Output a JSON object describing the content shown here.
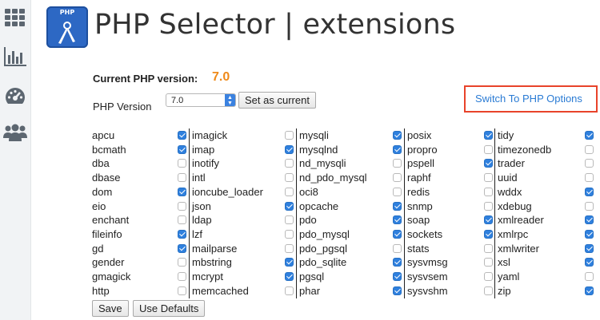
{
  "header": {
    "logo_text": "PHP",
    "title": "PHP Selector | extensions"
  },
  "current_version": {
    "label": "Current PHP version:",
    "value": "7.0"
  },
  "php_version": {
    "label": "PHP Version",
    "selected": "7.0",
    "set_current_label": "Set as current"
  },
  "switch_link": "Switch To PHP Options",
  "columns": [
    [
      {
        "name": "apcu",
        "checked": true
      },
      {
        "name": "bcmath",
        "checked": true
      },
      {
        "name": "dba",
        "checked": false
      },
      {
        "name": "dbase",
        "checked": false
      },
      {
        "name": "dom",
        "checked": true
      },
      {
        "name": "eio",
        "checked": false
      },
      {
        "name": "enchant",
        "checked": false
      },
      {
        "name": "fileinfo",
        "checked": true
      },
      {
        "name": "gd",
        "checked": true
      },
      {
        "name": "gender",
        "checked": false
      },
      {
        "name": "gmagick",
        "checked": false
      },
      {
        "name": "http",
        "checked": false
      }
    ],
    [
      {
        "name": "imagick",
        "checked": false
      },
      {
        "name": "imap",
        "checked": true
      },
      {
        "name": "inotify",
        "checked": false
      },
      {
        "name": "intl",
        "checked": false
      },
      {
        "name": "ioncube_loader",
        "checked": false
      },
      {
        "name": "json",
        "checked": true
      },
      {
        "name": "ldap",
        "checked": false
      },
      {
        "name": "lzf",
        "checked": false
      },
      {
        "name": "mailparse",
        "checked": false
      },
      {
        "name": "mbstring",
        "checked": true
      },
      {
        "name": "mcrypt",
        "checked": true
      },
      {
        "name": "memcached",
        "checked": false
      }
    ],
    [
      {
        "name": "mysqli",
        "checked": true
      },
      {
        "name": "mysqlnd",
        "checked": true
      },
      {
        "name": "nd_mysqli",
        "checked": false
      },
      {
        "name": "nd_pdo_mysql",
        "checked": false
      },
      {
        "name": "oci8",
        "checked": false
      },
      {
        "name": "opcache",
        "checked": true
      },
      {
        "name": "pdo",
        "checked": true
      },
      {
        "name": "pdo_mysql",
        "checked": true
      },
      {
        "name": "pdo_pgsql",
        "checked": false
      },
      {
        "name": "pdo_sqlite",
        "checked": true
      },
      {
        "name": "pgsql",
        "checked": true
      },
      {
        "name": "phar",
        "checked": true
      }
    ],
    [
      {
        "name": "posix",
        "checked": true
      },
      {
        "name": "propro",
        "checked": false
      },
      {
        "name": "pspell",
        "checked": true
      },
      {
        "name": "raphf",
        "checked": false
      },
      {
        "name": "redis",
        "checked": false
      },
      {
        "name": "snmp",
        "checked": false
      },
      {
        "name": "soap",
        "checked": true
      },
      {
        "name": "sockets",
        "checked": true
      },
      {
        "name": "stats",
        "checked": false
      },
      {
        "name": "sysvmsg",
        "checked": false
      },
      {
        "name": "sysvsem",
        "checked": false
      },
      {
        "name": "sysvshm",
        "checked": false
      }
    ],
    [
      {
        "name": "tidy",
        "checked": true
      },
      {
        "name": "timezonedb",
        "checked": false
      },
      {
        "name": "trader",
        "checked": false
      },
      {
        "name": "uuid",
        "checked": false
      },
      {
        "name": "wddx",
        "checked": true
      },
      {
        "name": "xdebug",
        "checked": false
      },
      {
        "name": "xmlreader",
        "checked": true
      },
      {
        "name": "xmlrpc",
        "checked": true
      },
      {
        "name": "xmlwriter",
        "checked": true
      },
      {
        "name": "xsl",
        "checked": true
      },
      {
        "name": "yaml",
        "checked": false
      },
      {
        "name": "zip",
        "checked": true
      }
    ]
  ],
  "actions": {
    "save_label": "Save",
    "defaults_label": "Use Defaults"
  },
  "colors": {
    "accent_orange": "#ef8a1a",
    "link_blue": "#2a7bd4",
    "checkbox_blue": "#2f80de",
    "highlight_red": "#e8432a"
  },
  "sidebar_icons": [
    "grid-icon",
    "bar-chart-icon",
    "dashboard-icon",
    "users-icon"
  ]
}
